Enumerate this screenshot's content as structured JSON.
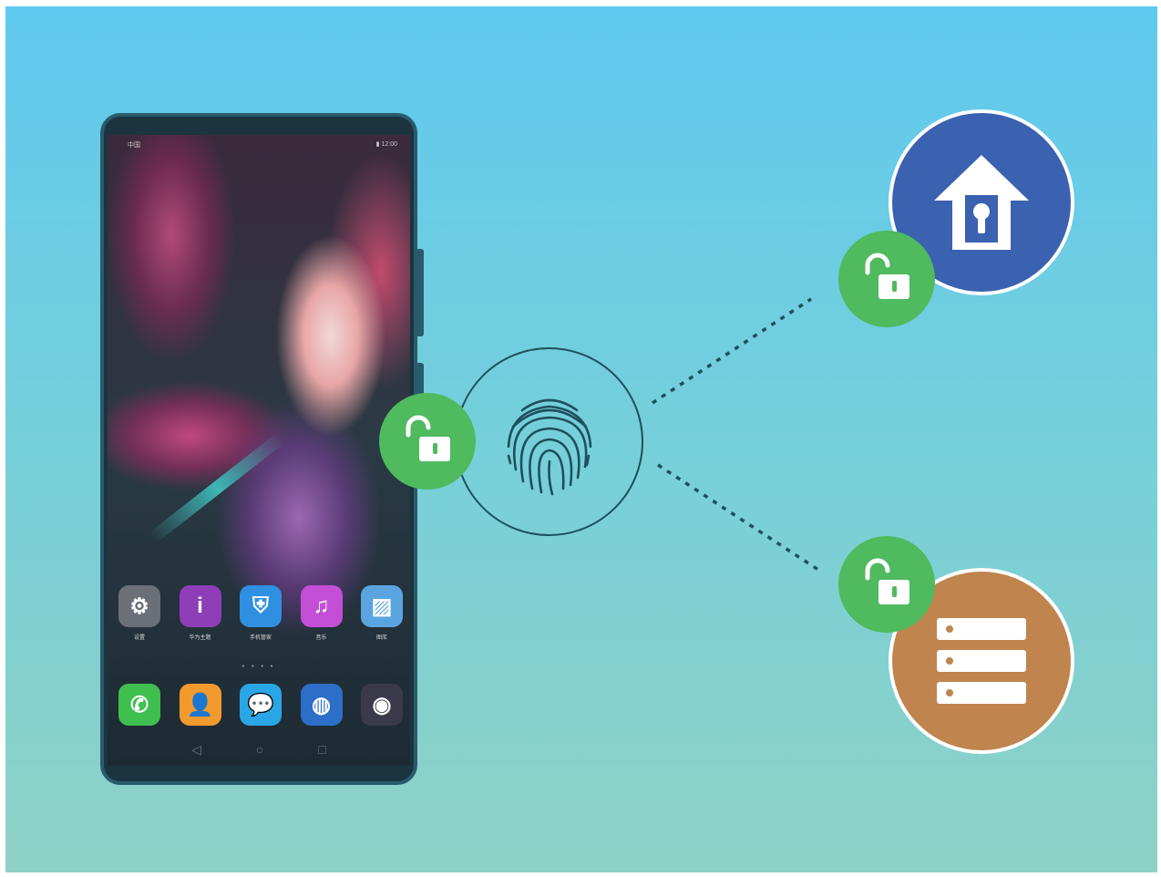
{
  "phone": {
    "status_left": "中国",
    "status_right": "▮ 12:00",
    "apps_row1": [
      {
        "icon": "settings-icon",
        "label": "设置",
        "glyph": "⚙",
        "color": "#6a6f78"
      },
      {
        "icon": "themes-icon",
        "label": "华为主题",
        "glyph": "i",
        "color": "#8e3fb8"
      },
      {
        "icon": "phone-manager-icon",
        "label": "手机管家",
        "glyph": "⛨",
        "color": "#2f8fe0"
      },
      {
        "icon": "music-icon",
        "label": "音乐",
        "glyph": "♫",
        "color": "#c24fd6"
      },
      {
        "icon": "gallery-icon",
        "label": "图库",
        "glyph": "▨",
        "color": "#5aa5e0"
      }
    ],
    "apps_row2": [
      {
        "icon": "phone-call-icon",
        "label": "",
        "glyph": "✆",
        "color": "#3fbf4f"
      },
      {
        "icon": "contacts-icon",
        "label": "",
        "glyph": "👤",
        "color": "#f39a2e"
      },
      {
        "icon": "messages-icon",
        "label": "",
        "glyph": "💬",
        "color": "#2aa6e6"
      },
      {
        "icon": "browser-icon",
        "label": "",
        "glyph": "◍",
        "color": "#2b6fc8"
      },
      {
        "icon": "camera-icon",
        "label": "",
        "glyph": "◉",
        "color": "#3a3a4a"
      }
    ],
    "page_dots": "• • • •",
    "nav": {
      "back": "◁",
      "home": "○",
      "recent": "□"
    }
  },
  "colors": {
    "lock_badge": "#4fba5e",
    "safe_circle": "#3a62b0",
    "vault_circle": "#c0844e",
    "fingerprint_stroke": "#1f4f5d"
  },
  "icons": [
    "fingerprint-icon",
    "unlock-icon",
    "safe-lock-icon",
    "file-vault-icon"
  ]
}
